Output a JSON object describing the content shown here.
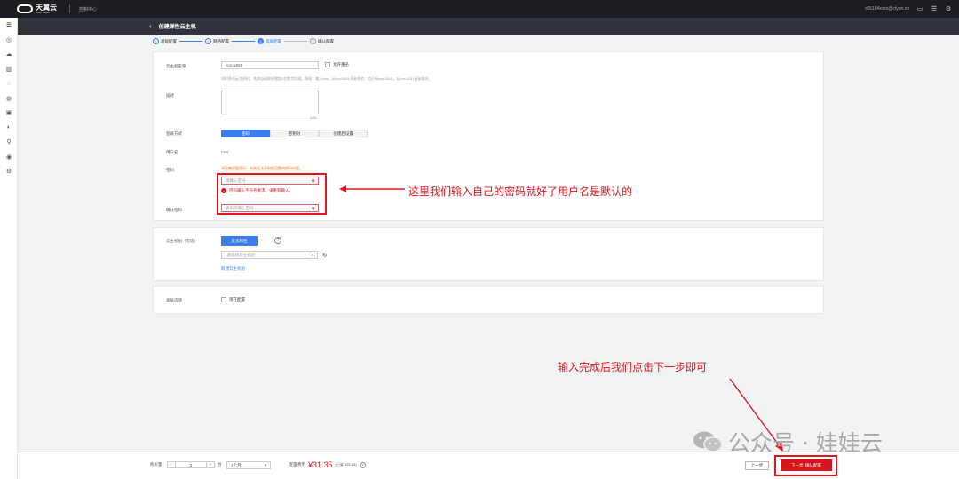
{
  "topbar": {
    "brand_cn": "天翼云",
    "brand_en": "State Cloud",
    "console": "控制中心",
    "account": "c65184xxxx@ctyun.cn"
  },
  "sidebar": {
    "icons": [
      "menu-icon",
      "server-icon",
      "cloud-icon",
      "db-icon",
      "storage-icon",
      "network-icon",
      "security-icon",
      "monitor-icon",
      "app-icon",
      "ops-icon",
      "settings-icon"
    ]
  },
  "header": {
    "back": "‹",
    "title": "创建弹性云主机"
  },
  "steps": [
    {
      "label": "基础配置",
      "state": "done"
    },
    {
      "label": "网络配置",
      "state": "done"
    },
    {
      "num": "3",
      "label": "高级配置",
      "state": "active"
    },
    {
      "num": "4",
      "label": "确认配置",
      "state": "todo"
    }
  ],
  "form": {
    "name_label": "云主机名称",
    "name_value": "ecs-a363",
    "allow_dup": "允许重名",
    "name_hint": "同时多台云主机时，名称自动按序增加4位数字后缀。例如：输入ecs，从ecs-0001开始命名；若已有ecs-0010，从ecs-0011开始命名。",
    "desc_label": "描述",
    "desc_counter": "0/85",
    "login_label": "登录方式",
    "login_tabs": [
      "密码",
      "密钥对",
      "创建后设置"
    ],
    "user_label": "用户名",
    "user_value": "root",
    "pwd_label": "密码",
    "pwd_warn": "请妥善保管密码，系统无法获取您设置的密码内容。",
    "pwd_placeholder": "请输入密码",
    "pwd_error": "密码输入不符合要求，请重新输入。",
    "confirm_label": "确认密码",
    "confirm_placeholder": "请再次输入密码"
  },
  "group": {
    "label": "云主机组（可选）",
    "anti_affinity": "反亲和性",
    "select_placeholder": "-请选择云主机组-",
    "link": "新建云主机组"
  },
  "advanced": {
    "label": "高级选项",
    "now_config": "现在配置"
  },
  "annotations": {
    "password": "这里我们输入自己的密码就好了用户名是默认的",
    "next": "输入完成后我们点击下一步即可"
  },
  "bottom": {
    "qty_label": "购买量",
    "qty": "1",
    "unit": "台",
    "duration": "1个月",
    "price_label": "配置费用",
    "price": "¥31.35",
    "price_detail": "(已省 ¥25.65)",
    "prev": "上一步",
    "next": "下一步: 确认配置"
  },
  "watermark": "公众号 · 娃娃云"
}
